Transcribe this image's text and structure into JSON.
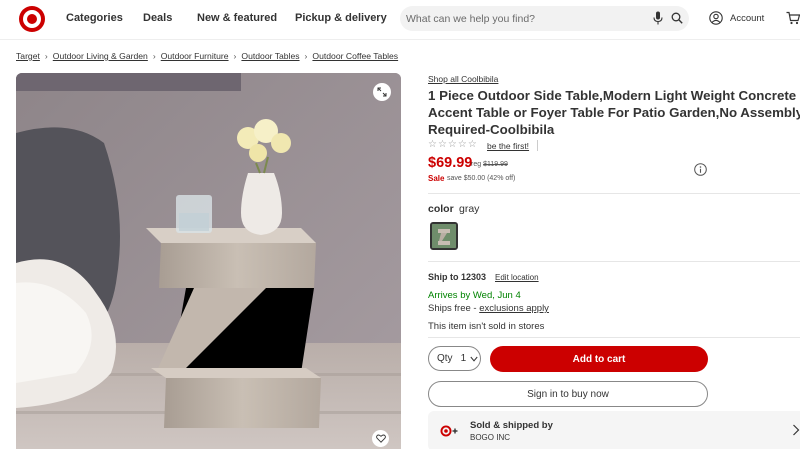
{
  "header": {
    "nav": [
      "Categories",
      "Deals",
      "New & featured",
      "Pickup & delivery"
    ],
    "search_placeholder": "What can we help you find?",
    "account_label": "Account"
  },
  "breadcrumb": [
    "Target",
    "Outdoor Living & Garden",
    "Outdoor Furniture",
    "Outdoor Tables",
    "Outdoor Coffee Tables"
  ],
  "product": {
    "brand_link": "Shop all Coolbibila",
    "title": "1 Piece Outdoor Side Table,Modern Light Weight Concrete Accent Table or Foyer Table For Patio Garden,No Assembly Required-Coolbibila",
    "rating_stars": "☆☆☆☆☆",
    "rating_link": "be the first!",
    "price": "$69.99",
    "reg_prefix": "reg",
    "reg_price": "$119.99",
    "sale_label": "Sale",
    "sale_savings": "save $50.00 (42% off)",
    "color_label": "color",
    "color_value": "gray"
  },
  "fulfillment": {
    "ship_to": "Ship to 12303",
    "edit_location": "Edit location",
    "arrives": "Arrives by Wed, Jun 4",
    "ships_free_prefix": "Ships free - ",
    "exclusions_link": "exclusions apply",
    "store_note": "This item isn't sold in stores"
  },
  "actions": {
    "qty_label": "Qty",
    "qty_value": "1",
    "add_to_cart": "Add to cart",
    "sign_in": "Sign in to buy now"
  },
  "seller": {
    "title": "Sold & shipped by",
    "name": "BOGO INC"
  },
  "colors": {
    "brand_red": "#cc0000",
    "arrival_green": "#008300"
  },
  "icons": [
    "target-logo-icon",
    "mic-icon",
    "search-icon",
    "account-icon",
    "cart-icon",
    "expand-icon",
    "heart-icon",
    "info-icon",
    "chevron-down-icon",
    "target-plus-icon",
    "chevron-right-icon"
  ]
}
